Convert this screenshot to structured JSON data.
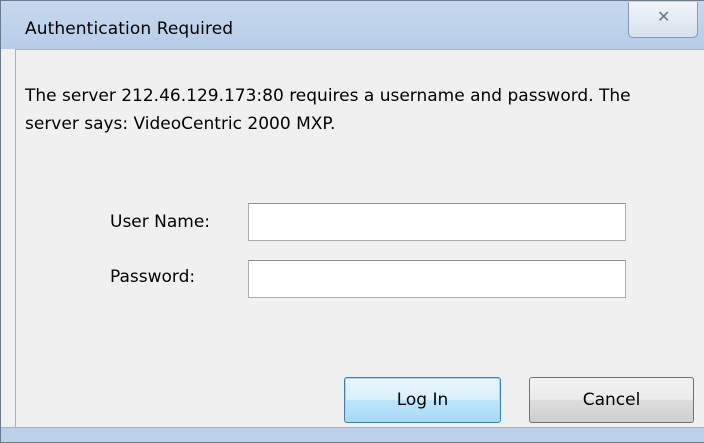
{
  "window": {
    "title": "Authentication Required",
    "close_glyph": "✕"
  },
  "dialog": {
    "message": "The server 212.46.129.173:80 requires a username and password. The server says: VideoCentric 2000 MXP.",
    "username_label": "User Name:",
    "username_value": "",
    "password_label": "Password:",
    "password_value": ""
  },
  "buttons": {
    "login_label": "Log In",
    "cancel_label": "Cancel"
  },
  "icons": {
    "close": "close-icon"
  }
}
